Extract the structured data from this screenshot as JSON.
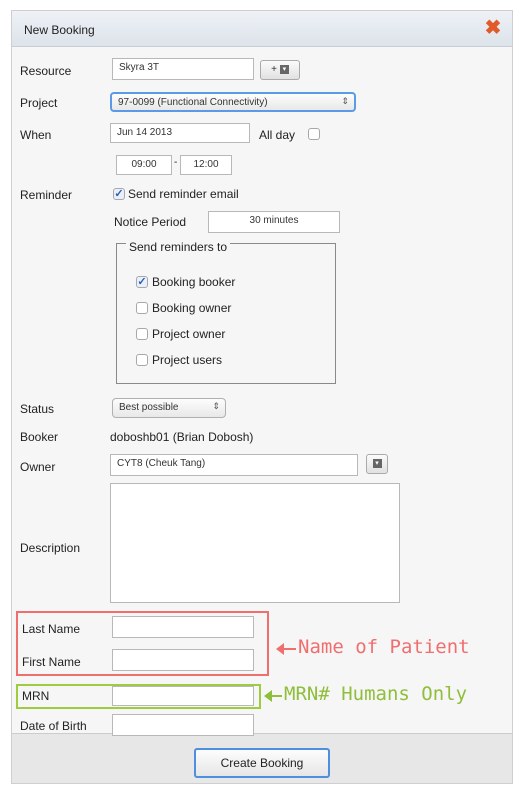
{
  "dialog": {
    "title": "New Booking",
    "close_icon": "close-icon",
    "create_button": "Create Booking"
  },
  "form": {
    "resource": {
      "label": "Resource",
      "value": "Skyra 3T",
      "add_button": "+"
    },
    "project": {
      "label": "Project",
      "value": "97-0099 (Functional Connectivity)"
    },
    "when": {
      "label": "When",
      "date": "Jun 14 2013",
      "all_day_label": "All day",
      "all_day_checked": false,
      "start_time": "09:00",
      "end_time": "12:00",
      "time_separator": "-"
    },
    "reminder": {
      "label": "Reminder",
      "send_email_label": "Send reminder email",
      "send_email_checked": true,
      "notice_label": "Notice Period",
      "notice_value": "30 minutes",
      "group_title": "Send reminders to",
      "options": [
        {
          "label": "Booking booker",
          "checked": true
        },
        {
          "label": "Booking owner",
          "checked": false
        },
        {
          "label": "Project owner",
          "checked": false
        },
        {
          "label": "Project users",
          "checked": false
        }
      ]
    },
    "status": {
      "label": "Status",
      "value": "Best possible"
    },
    "booker": {
      "label": "Booker",
      "value": "doboshb01 (Brian Dobosh)"
    },
    "owner": {
      "label": "Owner",
      "value": "CYT8 (Cheuk Tang)"
    },
    "description": {
      "label": "Description",
      "value": ""
    },
    "last_name": {
      "label": "Last Name",
      "value": ""
    },
    "first_name": {
      "label": "First Name",
      "value": ""
    },
    "mrn": {
      "label": "MRN",
      "value": ""
    },
    "dob": {
      "label": "Date of Birth",
      "value": ""
    }
  },
  "annotations": {
    "name_note": "Name of Patient",
    "mrn_note": "MRN# Humans Only",
    "red_color": "#ef6f6f",
    "green_color": "#8fbe3a"
  }
}
